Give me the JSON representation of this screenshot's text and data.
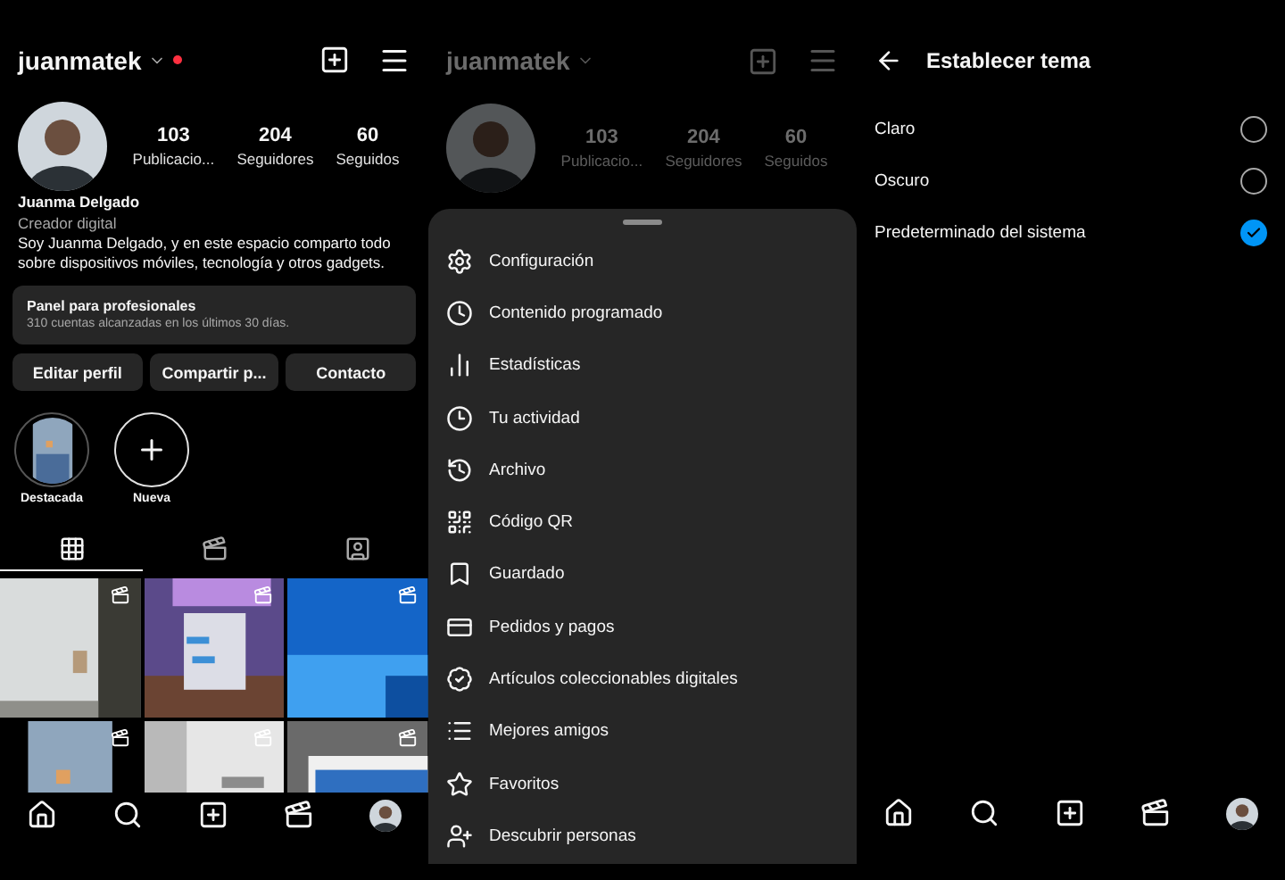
{
  "profile_screen": {
    "username": "juanmatek",
    "stats": [
      {
        "value": "103",
        "label": "Publicacio..."
      },
      {
        "value": "204",
        "label": "Seguidores"
      },
      {
        "value": "60",
        "label": "Seguidos"
      }
    ],
    "name": "Juanma Delgado",
    "category": "Creador digital",
    "bio": "Soy Juanma Delgado, y en este espacio comparto todo sobre dispositivos móviles, tecnología y otros gadgets.",
    "dashboard": {
      "title": "Panel para profesionales",
      "subtitle": "310 cuentas alcanzadas en los últimos 30 días."
    },
    "buttons": [
      "Editar perfil",
      "Compartir p...",
      "Contacto"
    ],
    "highlights": [
      {
        "label": "Destacada",
        "kind": "story"
      },
      {
        "label": "Nueva",
        "kind": "new"
      }
    ],
    "tabs": [
      {
        "kind": "grid",
        "selected": true
      },
      {
        "kind": "reels",
        "selected": false
      },
      {
        "kind": "tagged",
        "selected": false
      }
    ],
    "bottom_nav": [
      {
        "kind": "home"
      },
      {
        "kind": "search"
      },
      {
        "kind": "create"
      },
      {
        "kind": "reels"
      },
      {
        "kind": "profile"
      }
    ]
  },
  "menu_screen": {
    "username": "juanmatek",
    "stats": [
      {
        "value": "103",
        "label": "Publicacio..."
      },
      {
        "value": "204",
        "label": "Seguidores"
      },
      {
        "value": "60",
        "label": "Seguidos"
      }
    ],
    "items": [
      {
        "label": "Configuración",
        "kind": "settings"
      },
      {
        "label": "Contenido programado",
        "kind": "clock"
      },
      {
        "label": "Estadísticas",
        "kind": "chart"
      },
      {
        "label": "Tu actividad",
        "kind": "activity"
      },
      {
        "label": "Archivo",
        "kind": "archive"
      },
      {
        "label": "Código QR",
        "kind": "qr"
      },
      {
        "label": "Guardado",
        "kind": "bookmark"
      },
      {
        "label": "Pedidos y pagos",
        "kind": "card"
      },
      {
        "label": "Artículos coleccionables digitales",
        "kind": "badge"
      },
      {
        "label": "Mejores amigos",
        "kind": "list"
      },
      {
        "label": "Favoritos",
        "kind": "star"
      },
      {
        "label": "Descubrir personas",
        "kind": "people"
      }
    ]
  },
  "theme_screen": {
    "title": "Establecer tema",
    "options": [
      {
        "label": "Claro",
        "selected": false
      },
      {
        "label": "Oscuro",
        "selected": false
      },
      {
        "label": "Predeterminado del sistema",
        "selected": true
      }
    ],
    "bottom_nav": [
      {
        "kind": "home"
      },
      {
        "kind": "search"
      },
      {
        "kind": "create"
      },
      {
        "kind": "reels"
      },
      {
        "kind": "profile"
      }
    ]
  }
}
